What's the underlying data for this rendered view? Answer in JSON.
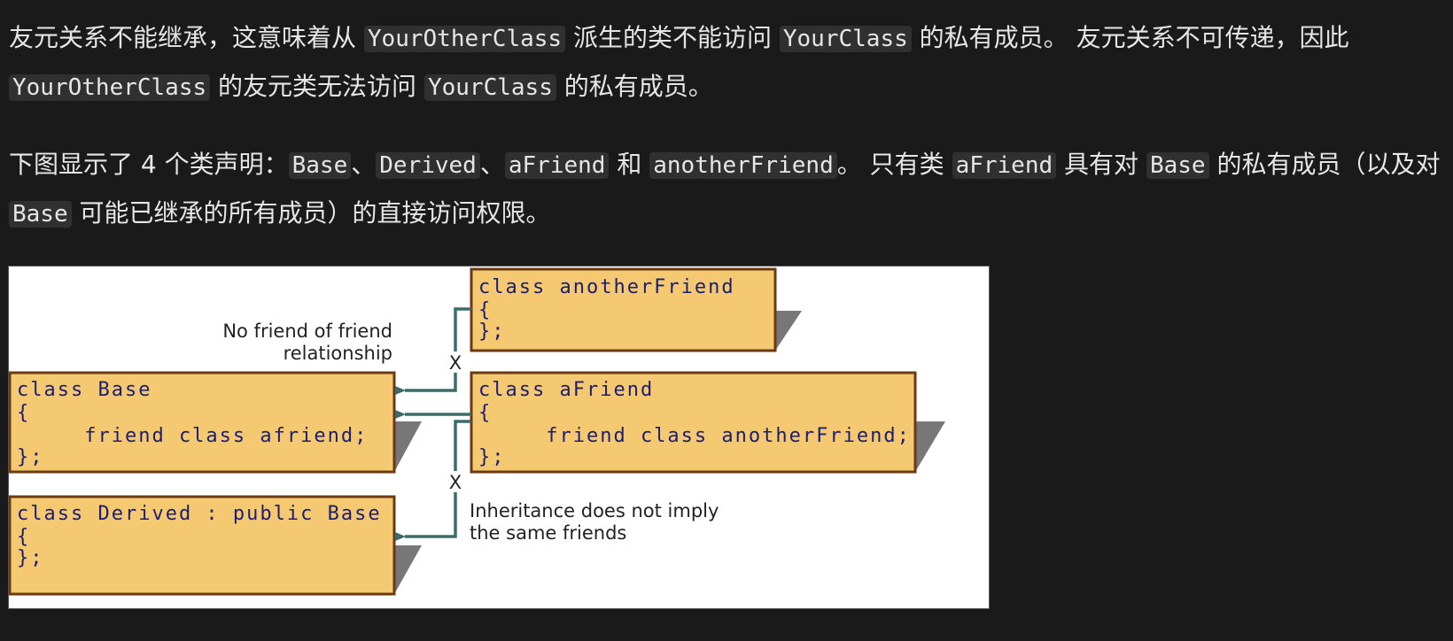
{
  "paragraph1": {
    "t1": "友元关系不能继承，这意味着从 ",
    "c1": "YourOtherClass",
    "t2": " 派生的类不能访问 ",
    "c2": "YourClass",
    "t3": " 的私有成员。 友元关系不可传递，因此 ",
    "c3": "YourOtherClass",
    "t4": " 的友元类无法访问 ",
    "c4": "YourClass",
    "t5": " 的私有成员。"
  },
  "paragraph2": {
    "t1": "下图显示了 4 个类声明：",
    "c1": "Base",
    "t2": "、",
    "c2": "Derived",
    "t3": "、",
    "c3": "aFriend",
    "t4": " 和 ",
    "c4": "anotherFriend",
    "t5": "。 只有类 ",
    "c5": "aFriend",
    "t6": " 具有对 ",
    "c6": "Base",
    "t7": " 的私有成员（以及对 ",
    "c7": "Base",
    "t8": " 可能已继承的所有成员）的直接访问权限。"
  },
  "diagram": {
    "boxes": {
      "another_friend": [
        "class anotherFriend",
        "{",
        "};"
      ],
      "base": [
        "class Base",
        "{",
        "     friend class afriend;",
        "};"
      ],
      "a_friend": [
        "class aFriend",
        "{",
        "     friend class anotherFriend;",
        "};"
      ],
      "derived": [
        "class Derived : public Base",
        "{",
        "};"
      ]
    },
    "notes": {
      "no_friend_line1": "No friend of friend",
      "no_friend_line2": "relationship",
      "inheritance_line1": "Inheritance does not imply",
      "inheritance_line2": "the same friends"
    },
    "x_mark_top": "X",
    "x_mark_bottom": "X",
    "colors": {
      "box_fill": "#f5c971",
      "box_border": "#6b3a12",
      "shadow": "#777777",
      "arrow": "#3d6b6b",
      "code_text": "#1e1e6e"
    }
  }
}
